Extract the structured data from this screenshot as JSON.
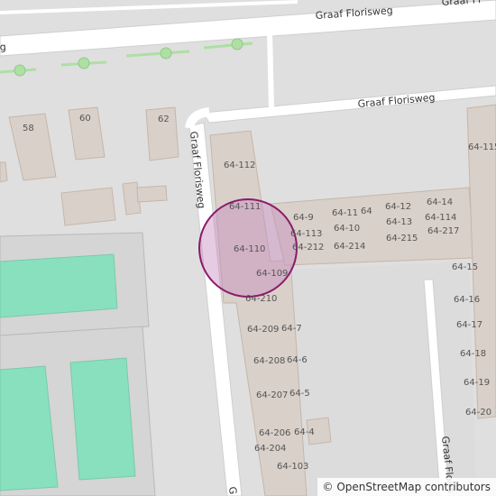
{
  "streets": {
    "top": "Graaf Florisweg",
    "top_right": "Graaf Fl",
    "left_edge": "g",
    "middle": "Graaf Florisweg",
    "vertical_left": "Graaf Florisweg",
    "vertical_right": "Graaf Floris",
    "bottom": "G"
  },
  "house_numbers": {
    "h58": "58",
    "h60": "60",
    "h62": "62",
    "n64_112": "64-112",
    "n64_111": "64-111",
    "n64_110": "64-110",
    "n64_109": "64-109",
    "n64_210": "64-210",
    "n64_9": "64-9",
    "n64_113": "64-113",
    "n64_212": "64-212",
    "n64_11": "64-11",
    "n64": "64",
    "n64_10": "64-10",
    "n64_214": "64-214",
    "n64_12": "64-12",
    "n64_13": "64-13",
    "n64_215": "64-215",
    "n64_14": "64-14",
    "n64_114": "64-114",
    "n64_217": "64-217",
    "n64_115": "64-115",
    "n64_15": "64-15",
    "n64_16": "64-16",
    "n64_17": "64-17",
    "n64_18": "64-18",
    "n64_19": "64-19",
    "n64_20": "64-20",
    "n64_209": "64-209",
    "n64_7": "64-7",
    "n64_208": "64-208",
    "n64_6": "64-6",
    "n64_207": "64-207",
    "n64_5": "64-5",
    "n64_206": "64-206",
    "n64_4": "64-4",
    "n64_204": "64-204",
    "n64_103": "64-103"
  },
  "attribution": {
    "copyright_symbol": "©",
    "link_text": "OpenStreetMap",
    "suffix": "contributors"
  },
  "colors": {
    "background": "#e0dfdf",
    "road": "#ffffff",
    "building": "#d9d0c9",
    "building_stroke": "#c4b6ab",
    "pitch": "#88e0be",
    "tree_row": "#aedfa3",
    "marker_fill": "rgba(200,140,190,0.45)",
    "marker_stroke": "#8b1a6b"
  }
}
